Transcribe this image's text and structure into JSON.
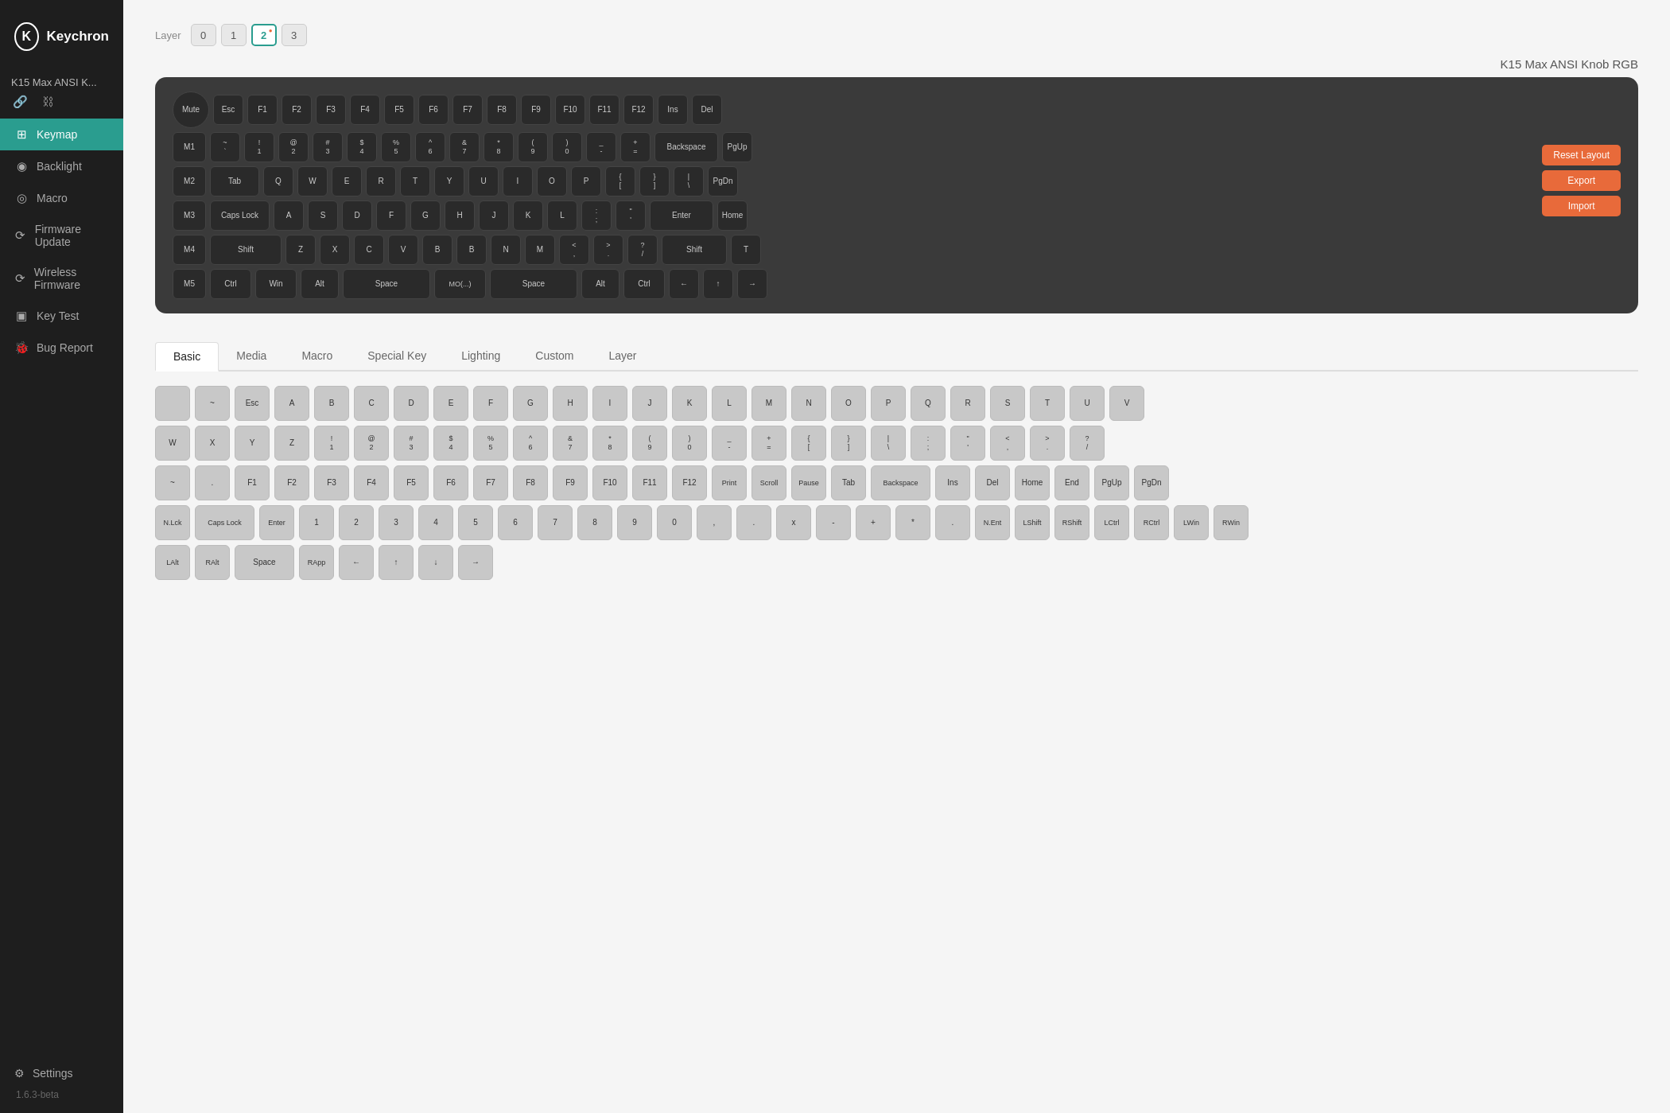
{
  "sidebar": {
    "logo": {
      "icon": "K",
      "text": "Keychron"
    },
    "device": {
      "name": "K15 Max ANSI K...",
      "link_icon": "🔗",
      "unlink_icon": "🔗"
    },
    "nav_items": [
      {
        "id": "keymap",
        "label": "Keymap",
        "icon": "⌨",
        "active": true
      },
      {
        "id": "backlight",
        "label": "Backlight",
        "icon": "💡",
        "active": false
      },
      {
        "id": "macro",
        "label": "Macro",
        "icon": "◎",
        "active": false
      },
      {
        "id": "firmware-update",
        "label": "Firmware Update",
        "icon": "⟳",
        "active": false
      },
      {
        "id": "wireless-firmware",
        "label": "Wireless Firmware",
        "icon": "⟳",
        "active": false
      },
      {
        "id": "key-test",
        "label": "Key Test",
        "icon": "◻",
        "active": false
      },
      {
        "id": "bug-report",
        "label": "Bug Report",
        "icon": "🐞",
        "active": false
      }
    ],
    "settings_label": "Settings",
    "version": "1.6.3-beta"
  },
  "header": {
    "layer_label": "Layer",
    "layers": [
      "0",
      "1",
      "2",
      "3"
    ],
    "active_layer": "2",
    "model_name": "K15 Max ANSI Knob RGB"
  },
  "action_buttons": {
    "reset_layout": "Reset Layout",
    "export": "Export",
    "import": "Import"
  },
  "tabs": {
    "items": [
      "Basic",
      "Media",
      "Macro",
      "Special Key",
      "Lighting",
      "Custom",
      "Layer"
    ],
    "active": "Basic"
  },
  "keyboard": {
    "rows": [
      [
        "Mute",
        "Esc",
        "F1",
        "F2",
        "F3",
        "F4",
        "F5",
        "F6",
        "F7",
        "F8",
        "F9",
        "F10",
        "F11",
        "F12",
        "Ins",
        "Del"
      ],
      [
        "M1",
        "~",
        "!",
        "@",
        "#",
        "$",
        "%",
        "^",
        "&",
        "*",
        "(",
        ")",
        "_",
        "+",
        "Backspace",
        "PgUp"
      ],
      [
        "M2",
        "Tab",
        "Q",
        "W",
        "E",
        "R",
        "T",
        "Y",
        "U",
        "I",
        "O",
        "P",
        "{",
        "}",
        "|",
        "PgDn"
      ],
      [
        "M3",
        "Caps Lock",
        "A",
        "S",
        "D",
        "F",
        "G",
        "H",
        "J",
        "K",
        "L",
        ":",
        "\"",
        "Enter",
        "Home"
      ],
      [
        "M4",
        "Shift",
        "Z",
        "X",
        "C",
        "V",
        "B",
        "B",
        "N",
        "M",
        "<",
        ">",
        "?",
        "Shift",
        "T"
      ],
      [
        "M5",
        "Ctrl",
        "Win",
        "Alt",
        "Space",
        "MO(...)",
        "Space",
        "Alt",
        "Ctrl",
        "←",
        "↑",
        "→"
      ]
    ]
  },
  "sel_keys_row1": [
    "",
    "~",
    "Esc",
    "A",
    "B",
    "C",
    "D",
    "E",
    "F",
    "G",
    "H",
    "I",
    "J",
    "K",
    "L",
    "M",
    "N",
    "O",
    "P",
    "Q",
    "R",
    "S",
    "T",
    "U",
    "V"
  ],
  "sel_keys_row2": [
    "W",
    "X",
    "Y",
    "Z",
    "!",
    "@",
    "#",
    "$",
    "%",
    "^",
    "&",
    "*",
    "(",
    ")",
    "_",
    "+",
    "{",
    "}",
    "\\",
    ":",
    ";",
    "<",
    ">",
    "?",
    "/"
  ],
  "sel_keys_row3": [
    "~",
    ".",
    "F1",
    "F2",
    "F3",
    "F4",
    "F5",
    "F6",
    "F7",
    "F8",
    "F9",
    "F10",
    "F11",
    "F12",
    "Print",
    "Scroll",
    "Pause",
    "Tab",
    "Backspace",
    "Ins",
    "Del",
    "Home",
    "End",
    "PgUp",
    "PgDn"
  ],
  "sel_keys_row4": [
    "N.Lck",
    "Caps Lock",
    "Enter",
    "1",
    "2",
    "3",
    "4",
    "5",
    "6",
    "7",
    "8",
    "9",
    "0",
    ",",
    ".",
    "x",
    "-",
    "+",
    "*",
    ".",
    "N.Ent",
    "LShift",
    "RShift",
    "LCtrl",
    "RCtrl",
    "LWin",
    "RWin"
  ],
  "sel_keys_row5": [
    "LAlt",
    "RAlt",
    "Space",
    "RApp",
    "←",
    "↑",
    "↓",
    "→"
  ]
}
